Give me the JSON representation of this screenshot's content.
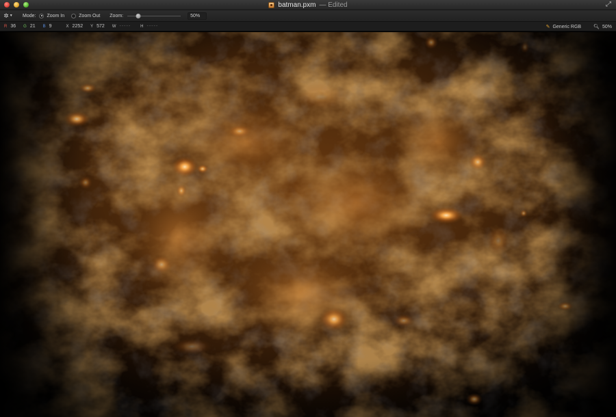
{
  "window": {
    "title": "batman.pxm",
    "edited_suffix": "— Edited"
  },
  "toolbar": {
    "mode_label": "Mode:",
    "zoom_in_label": "Zoom In",
    "zoom_out_label": "Zoom Out",
    "selected_mode": "Zoom In",
    "zoom_label": "Zoom:",
    "zoom_value": "50%",
    "zoom_slider_fraction": 0.2
  },
  "infobar": {
    "r_key": "R",
    "r_val": "36",
    "g_key": "G",
    "g_val": "21",
    "b_key": "B",
    "b_val": "9",
    "x_key": "X",
    "x_val": "2252",
    "y_key": "Y",
    "y_val": "572",
    "w_key": "W",
    "w_val": "-----",
    "h_key": "H",
    "h_val": "-----",
    "color_profile": "Generic RGB",
    "zoom": "50%"
  },
  "icons": {
    "gear": "gear-icon",
    "document": "document-icon",
    "fullscreen": "fullscreen-icon",
    "magnifier": "magnifier-icon",
    "color_profile": "color-profile-icon"
  },
  "colors": {
    "nebula_glow": "#ff9a3a",
    "nebula_mid": "#8a4a14",
    "background": "#000000",
    "r_key": "#e2574a",
    "g_key": "#6ec15a",
    "b_key": "#5a8fe2"
  }
}
